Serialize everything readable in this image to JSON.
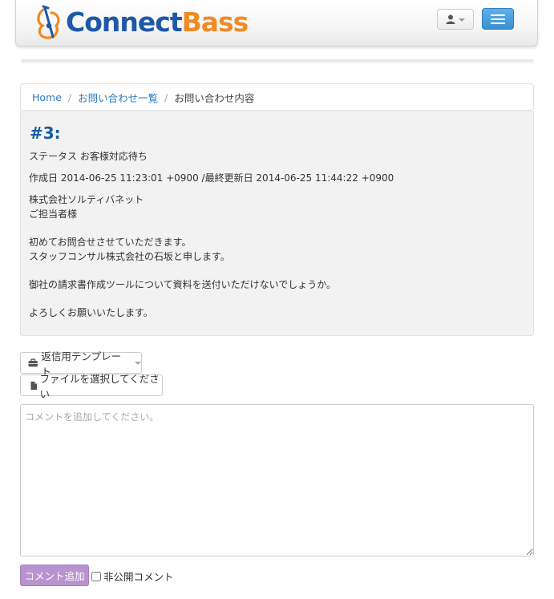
{
  "header": {
    "brand_connect": "Connect",
    "brand_bass": "Bass"
  },
  "breadcrumb": {
    "home": "Home",
    "list": "お問い合わせ一覧",
    "current": "お問い合わせ内容",
    "separator": "/"
  },
  "ticket": {
    "title": "#3:",
    "status_label": "ステータス",
    "status_value": "お客様対応待ち",
    "created_label": "作成日",
    "created_value": "2014-06-25 11:23:01 +0900",
    "updated_separator": "/",
    "updated_label": "最終更新日",
    "updated_value": "2014-06-25 11:44:22 +0900",
    "body": {
      "line1": "株式会社ソルティバネット",
      "line2": "ご担当者様",
      "line3": "初めてお問合せさせていただきます。",
      "line4": "スタッフコンサル株式会社の石坂と申します。",
      "line5": "御社の請求書作成ツールについて資料を送付いただけないでしょうか。",
      "line6": "よろしくお願いいたします。"
    }
  },
  "actions": {
    "template_label": "返信用テンプレート",
    "file_label": "ファイルを選択してください",
    "comment_placeholder": "コメントを追加してください。",
    "submit_label": "コメント追加",
    "private_label": "非公開コメント"
  },
  "colors": {
    "brand_blue": "#1e58a8",
    "brand_orange": "#f08a24",
    "link": "#2a7bbf",
    "submit": "#b794cf"
  }
}
